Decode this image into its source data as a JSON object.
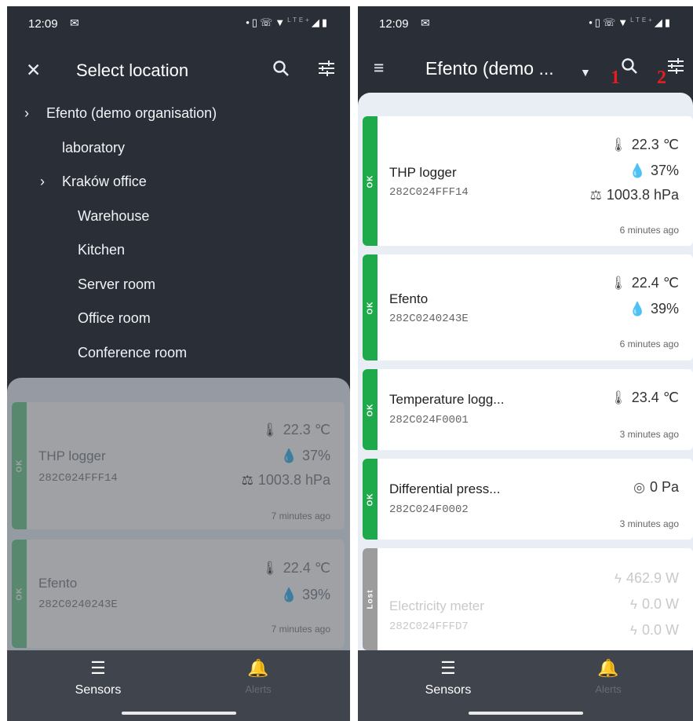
{
  "left_screen": {
    "status_bar": {
      "time": "12:09",
      "notif_icon": "gmail-icon",
      "lte_small": "LTE+"
    },
    "top_bar": {
      "title": "Select location"
    },
    "tree": [
      {
        "label": "Efento (demo organisation)",
        "expandable": true,
        "level": 0
      },
      {
        "label": "laboratory",
        "expandable": false,
        "level": 1
      },
      {
        "label": "Kraków office",
        "expandable": true,
        "level": 1
      },
      {
        "label": "Warehouse",
        "expandable": false,
        "level": 2
      },
      {
        "label": "Kitchen",
        "expandable": false,
        "level": 2
      },
      {
        "label": "Server room",
        "expandable": false,
        "level": 2
      },
      {
        "label": "Office room",
        "expandable": false,
        "level": 2
      },
      {
        "label": "Conference room",
        "expandable": false,
        "level": 2
      }
    ],
    "cards": [
      {
        "status": "OK",
        "name": "THP logger",
        "serial": "282C024FFF14",
        "temperature": "22.3 ℃",
        "humidity": "37%",
        "pressure": "1003.8 hPa",
        "updated": "7 minutes ago"
      },
      {
        "status": "OK",
        "name": "Efento",
        "serial": "282C0240243E",
        "temperature": "22.4 ℃",
        "humidity": "39%",
        "updated": "7 minutes ago"
      }
    ],
    "bottom_nav": {
      "sensors": "Sensors",
      "alerts": "Alerts"
    }
  },
  "right_screen": {
    "status_bar": {
      "time": "12:09",
      "notif_icon": "gmail-icon",
      "lte_small": "LTE+"
    },
    "top_bar": {
      "title": "Efento (demo ...",
      "annotation_1": "1",
      "annotation_2": "2"
    },
    "cards": [
      {
        "status": "OK",
        "name": "THP logger",
        "serial": "282C024FFF14",
        "temperature": "22.3 ℃",
        "humidity": "37%",
        "pressure": "1003.8 hPa",
        "updated": "6 minutes ago"
      },
      {
        "status": "OK",
        "name": "Efento",
        "serial": "282C0240243E",
        "temperature": "22.4 ℃",
        "humidity": "39%",
        "updated": "6 minutes ago"
      },
      {
        "status": "OK",
        "name": "Temperature logg...",
        "serial": "282C024F0001",
        "temperature": "23.4 ℃",
        "updated": "3 minutes ago"
      },
      {
        "status": "OK",
        "name": "Differential press...",
        "serial": "282C024F0002",
        "diff_pressure": "0 Pa",
        "updated": "3 minutes ago"
      },
      {
        "status": "Lost",
        "name": "Electricity meter",
        "serial": "282C024FFFD7",
        "power_1": "462.9 W",
        "power_2": "0.0 W",
        "power_3": "0.0 W"
      }
    ],
    "bottom_nav": {
      "sensors": "Sensors",
      "alerts": "Alerts"
    }
  },
  "colors": {
    "app_bar": "#2a2e37",
    "ok_strip": "#1ea94a",
    "lost_strip": "#9c9c9c",
    "bottom_nav": "#40444d",
    "annotation": "#e02020"
  }
}
